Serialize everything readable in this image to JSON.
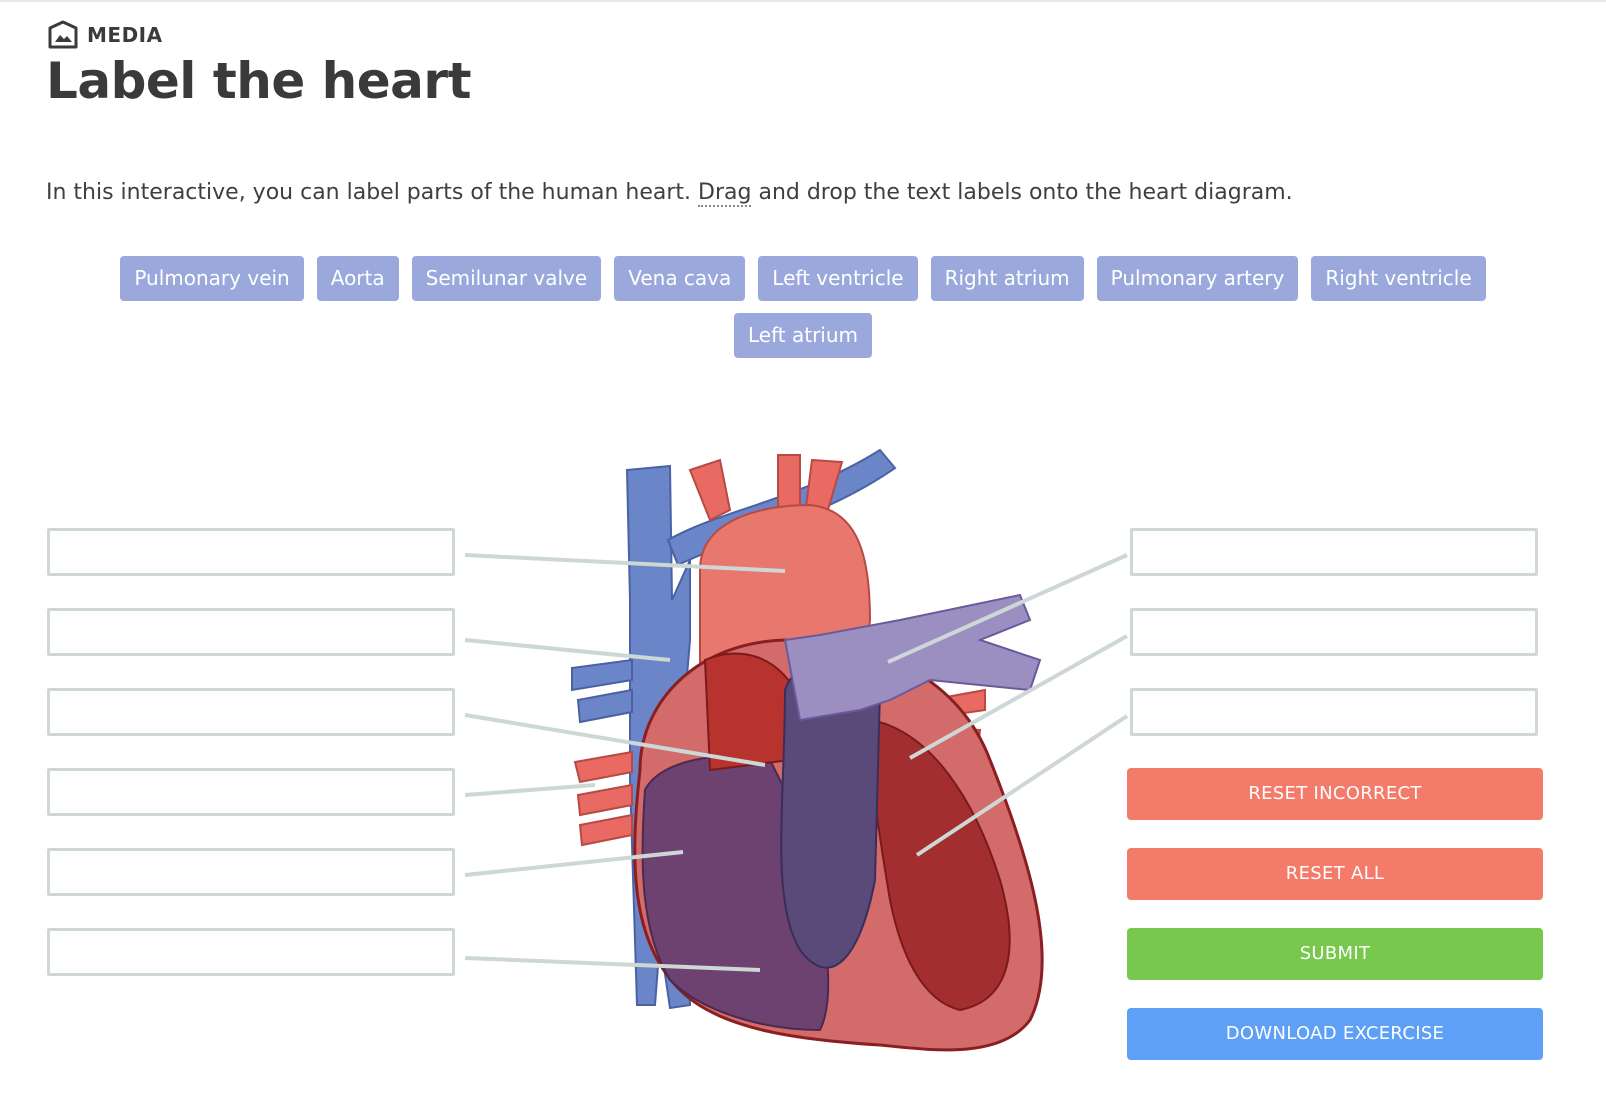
{
  "header": {
    "tag": "MEDIA",
    "title": "Label the heart"
  },
  "intro": {
    "before": "In this interactive, you can label parts of the human heart. ",
    "abbr": "Drag",
    "after": " and drop the text labels onto the heart diagram."
  },
  "labels": {
    "row1": [
      "Pulmonary vein",
      "Aorta",
      "Semilunar valve",
      "Vena cava",
      "Left ventricle",
      "Right atrium",
      "Pulmonary artery",
      "Right ventricle"
    ],
    "row2": [
      "Left atrium"
    ]
  },
  "buttons": {
    "reset_incorrect": "RESET INCORRECT",
    "reset_all": "RESET ALL",
    "submit": "SUBMIT",
    "download": "DOWNLOAD EXCERCISE"
  },
  "colors": {
    "chip": "#9aa8dc",
    "reset": "#f47b6a",
    "submit": "#77c84c",
    "download": "#5ea0f6",
    "dropzone_border": "#cfd7d7"
  }
}
